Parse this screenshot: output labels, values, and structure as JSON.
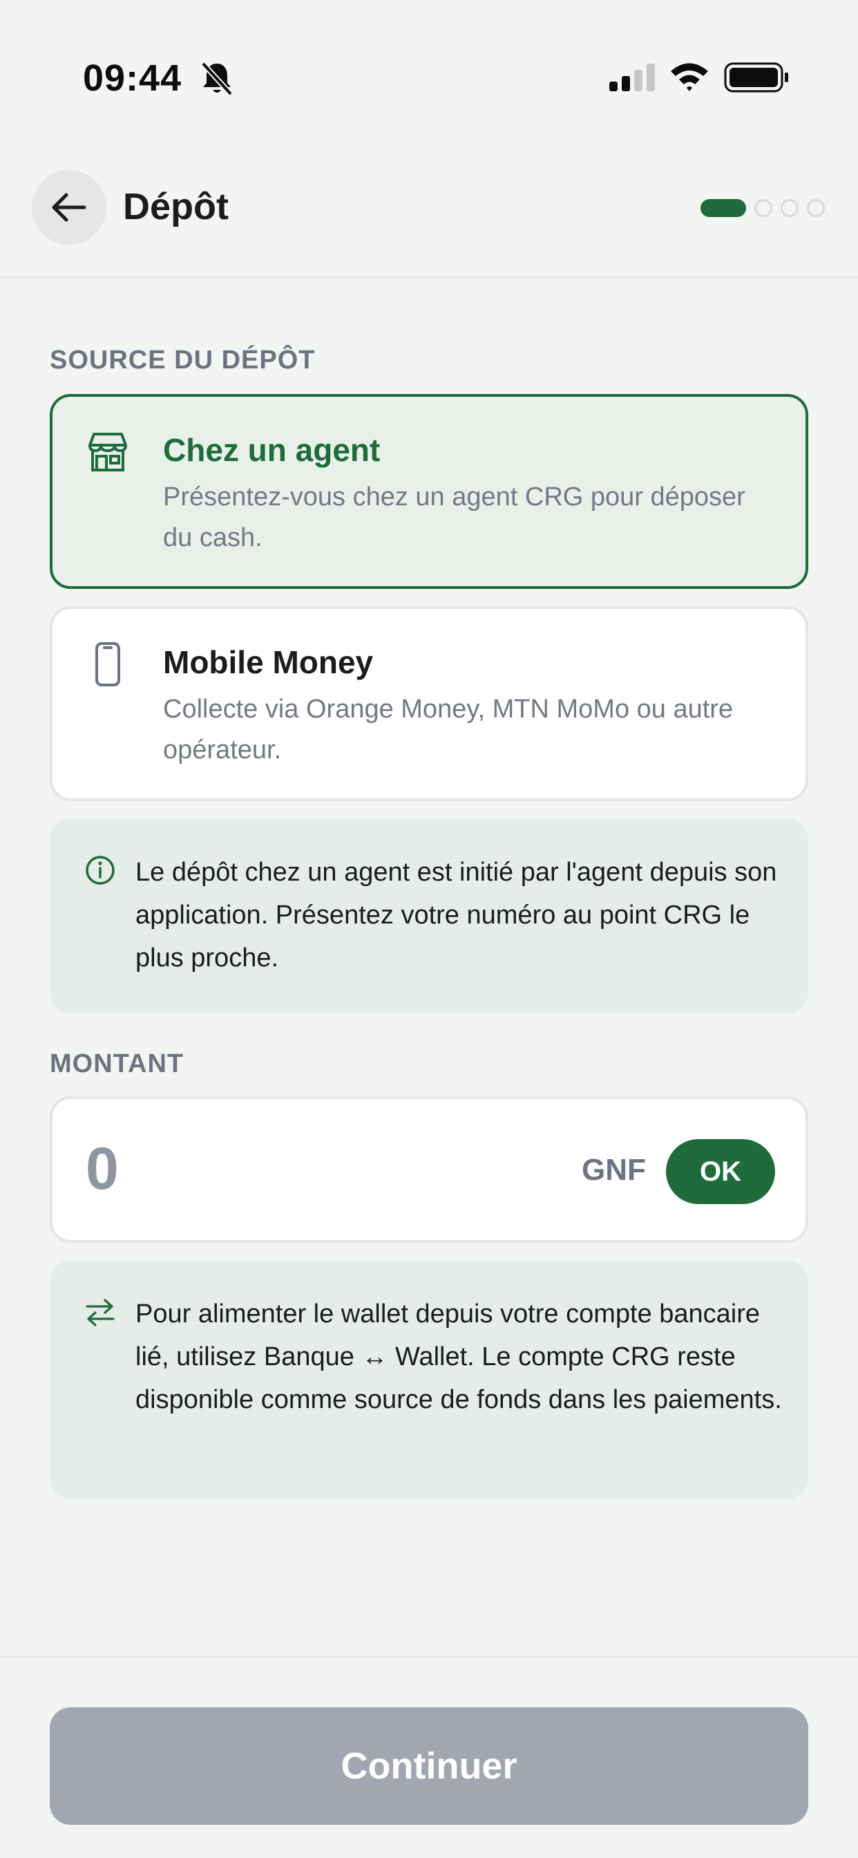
{
  "status_bar": {
    "time": "09:44",
    "icons": [
      "bell-slash-icon",
      "signal-icon",
      "wifi-icon",
      "battery-icon"
    ]
  },
  "header": {
    "title": "Dépôt",
    "back_icon": "arrow-left-icon",
    "steps_total": 4,
    "step_current": 1
  },
  "source": {
    "label": "SOURCE DU DÉPÔT",
    "options": [
      {
        "title": "Chez un agent",
        "description": "Présentez-vous chez un agent CRG pour déposer du cash.",
        "icon": "storefront-icon",
        "selected": true
      },
      {
        "title": "Mobile Money",
        "description": "Collecte via Orange Money, MTN MoMo ou autre opérateur.",
        "icon": "smartphone-icon",
        "selected": false
      }
    ]
  },
  "agent_info": {
    "icon": "info-icon",
    "text": "Le dépôt chez un agent est initié par l'agent depuis son application. Présentez votre numéro au point CRG le plus proche."
  },
  "amount": {
    "label": "MONTANT",
    "placeholder": "0",
    "value": "",
    "currency": "GNF",
    "ok_label": "OK"
  },
  "wallet_info": {
    "icon": "transfer-arrows-icon",
    "text": "Pour alimenter le wallet depuis votre compte bancaire lié, utilisez Banque ↔ Wallet. Le compte CRG reste disponible comme source de fonds dans les paiements."
  },
  "footer": {
    "continue_label": "Continuer"
  },
  "colors": {
    "primary": "#1e6b3b",
    "background": "#f3f5f2",
    "info_background": "#e6ece8",
    "selected_background": "#e9f0ea",
    "disabled_button": "#a2a6b0",
    "muted_text": "#6c7280"
  }
}
